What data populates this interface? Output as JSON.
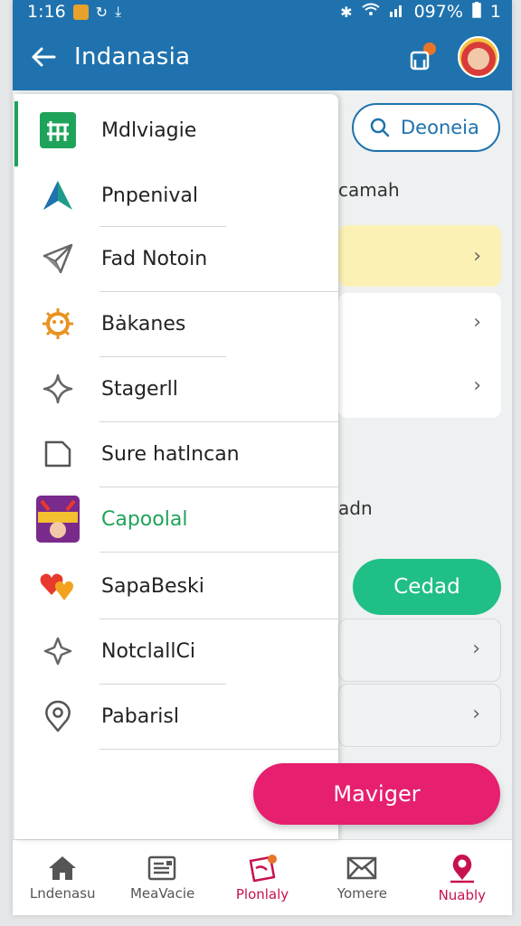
{
  "status_bar": {
    "time": "1:16",
    "battery": "097%",
    "extra": "1"
  },
  "app_bar": {
    "title": "Indanasia"
  },
  "background": {
    "search_label": "Deoneia",
    "text_1": "camah",
    "text_2": "adn",
    "green_button": "Cedad"
  },
  "fab": {
    "label": "Maviger"
  },
  "drawer": {
    "items": [
      {
        "label": "Mdlviagie",
        "icon": "grid-logo-icon"
      },
      {
        "label": "Pnpenival",
        "icon": "mountain-icon"
      },
      {
        "label": "Fad Notoin",
        "icon": "send-icon"
      },
      {
        "label": "Bȧkanes",
        "icon": "sun-face-icon"
      },
      {
        "label": "Stagerll",
        "icon": "sparkle-icon"
      },
      {
        "label": "Sure hatlncan",
        "icon": "note-icon"
      },
      {
        "label": "Capoolal",
        "icon": "game-art-icon"
      },
      {
        "label": "SapaBeski",
        "icon": "hearts-icon"
      },
      {
        "label": "NotclallCi",
        "icon": "star-outline-icon"
      },
      {
        "label": "Pabarisl",
        "icon": "location-pin-icon"
      }
    ]
  },
  "bottom_nav": {
    "items": [
      {
        "label": "Lndenasu",
        "icon": "home-icon"
      },
      {
        "label": "MeaVacie",
        "icon": "news-icon"
      },
      {
        "label": "Plonlaly",
        "icon": "ticket-icon"
      },
      {
        "label": "Yomere",
        "icon": "mail-icon"
      },
      {
        "label": "Nuably",
        "icon": "profile-pin-icon"
      }
    ]
  },
  "colors": {
    "primary": "#1f72ad",
    "accent_green": "#1fbf86",
    "accent_pink": "#e61f6e",
    "active_nav": "#c7124e"
  }
}
